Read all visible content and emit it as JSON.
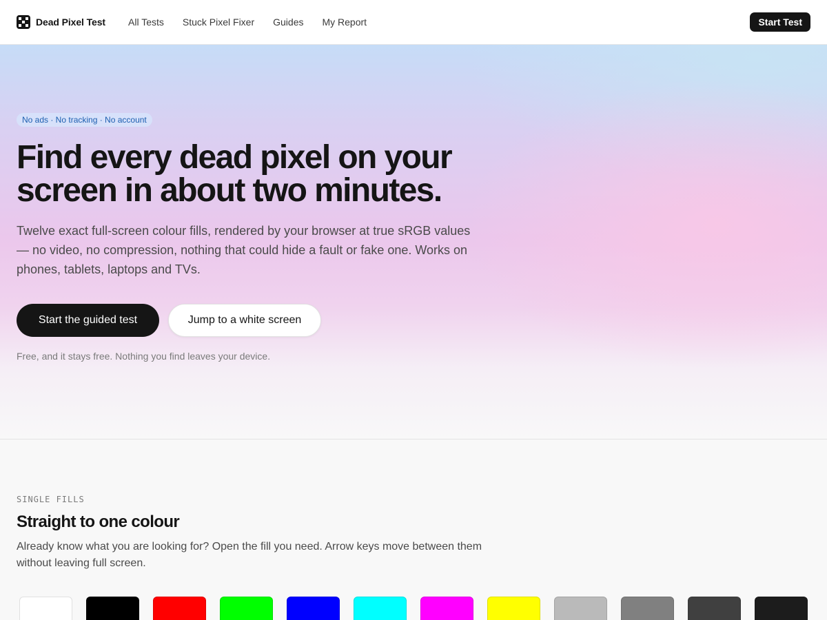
{
  "header": {
    "brand": "Dead Pixel Test",
    "nav": [
      "All Tests",
      "Stuck Pixel Fixer",
      "Guides",
      "My Report"
    ],
    "cta": "Start Test"
  },
  "hero": {
    "badge": "No ads · No tracking · No account",
    "title_line1": "Find every dead pixel on your",
    "title_line2": "screen in about two minutes.",
    "subtitle": "Twelve exact full-screen colour fills, rendered by your browser at true sRGB values — no video, no compression, nothing that could hide a fault or fake one. Works on phones, tablets, laptops and TVs.",
    "primary_button": "Start the guided test",
    "secondary_button": "Jump to a white screen",
    "note": "Free, and it stays free. Nothing you find leaves your device."
  },
  "fills": {
    "eyebrow": "SINGLE FILLS",
    "title": "Straight to one colour",
    "body": "Already know what you are looking for? Open the fill you need. Arrow keys move between them without leaving full screen.",
    "swatches": [
      {
        "name": "white",
        "color": "#ffffff"
      },
      {
        "name": "black",
        "color": "#000000"
      },
      {
        "name": "red",
        "color": "#ff0000"
      },
      {
        "name": "green",
        "color": "#00ff00"
      },
      {
        "name": "blue",
        "color": "#0000ff"
      },
      {
        "name": "cyan",
        "color": "#00ffff"
      },
      {
        "name": "magenta",
        "color": "#ff00ff"
      },
      {
        "name": "yellow",
        "color": "#ffff00"
      },
      {
        "name": "light-grey",
        "color": "#bababa"
      },
      {
        "name": "mid-grey",
        "color": "#808080"
      },
      {
        "name": "dark-grey",
        "color": "#404040"
      },
      {
        "name": "near-black",
        "color": "#1c1c1c"
      }
    ]
  }
}
